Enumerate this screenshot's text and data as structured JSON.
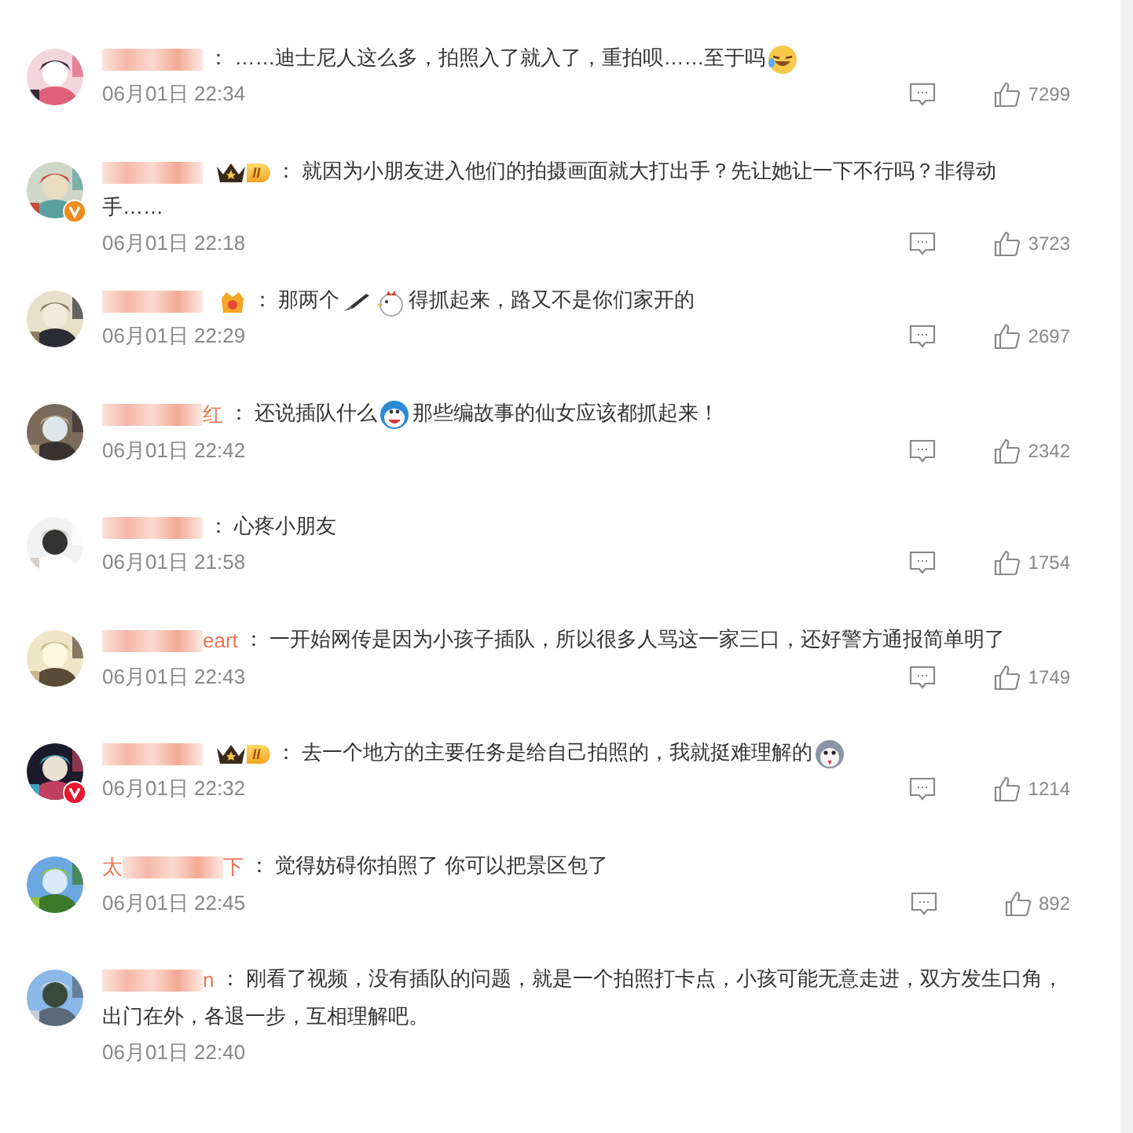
{
  "comments": [
    {
      "parts": [
        {
          "kind": "text",
          "text": "： ……迪士尼人这么多，拍照入了就入了，重拍呗……至于吗"
        },
        {
          "kind": "laugh"
        }
      ],
      "date": "06月01日 22:34",
      "likes": "7299"
    },
    {
      "badge": {
        "kind": "crown",
        "level": "II"
      },
      "verified": {
        "color": "#f08a1c"
      },
      "parts": [
        {
          "kind": "text",
          "text": "： 就因为小朋友进入他们的拍摄画面就大打出手？先让她让一下不行吗？非得动"
        },
        {
          "kind": "line",
          "text": "手……"
        }
      ],
      "date": "06月01日 22:18",
      "likes": "3723"
    },
    {
      "badge": {
        "kind": "medal"
      },
      "parts": [
        {
          "kind": "text",
          "text": "： 那两个"
        },
        {
          "kind": "knife"
        },
        {
          "kind": "chicken"
        },
        {
          "kind": "text",
          "text": "得抓起来，路又不是你们家开的"
        }
      ],
      "date": "06月01日 22:29",
      "likes": "2697"
    },
    {
      "name": {
        "tail": "红"
      },
      "parts": [
        {
          "kind": "text",
          "text": "： 还说插队什么"
        },
        {
          "kind": "cartoon"
        },
        {
          "kind": "text",
          "text": "那些编故事的仙女应该都抓起来！"
        }
      ],
      "date": "06月01日 22:42",
      "likes": "2342"
    },
    {
      "parts": [
        {
          "kind": "text",
          "text": "： 心疼小朋友"
        }
      ],
      "date": "06月01日 21:58",
      "likes": "1754"
    },
    {
      "name": {
        "tail": "eart"
      },
      "parts": [
        {
          "kind": "text",
          "text": "： 一开始网传是因为小孩子插队，所以很多人骂这一家三口，还好警方通报简单明了"
        }
      ],
      "date": "06月01日 22:43",
      "likes": "1749"
    },
    {
      "badge": {
        "kind": "crown",
        "level": "II"
      },
      "verified": {
        "color": "#e6162d"
      },
      "parts": [
        {
          "kind": "text",
          "text": "： 去一个地方的主要任务是给自己拍照的，我就挺难理解的"
        },
        {
          "kind": "dog"
        }
      ],
      "date": "06月01日 22:32",
      "likes": "1214"
    },
    {
      "name": {
        "head": "太",
        "tail": "下"
      },
      "parts": [
        {
          "kind": "text",
          "text": "： 觉得妨碍你拍照了 你可以把景区包了"
        }
      ],
      "date": "06月01日 22:45",
      "likes": "892"
    },
    {
      "name": {
        "tail": "n"
      },
      "parts": [
        {
          "kind": "text",
          "text": "： 刚看了视频，没有插队的问题，就是一个拍照打卡点，小孩可能无意走进，双方发生口角，"
        },
        {
          "kind": "line",
          "text": "出门在外，各退一步，互相理解吧。"
        }
      ],
      "date": "06月01日 22:40"
    }
  ]
}
